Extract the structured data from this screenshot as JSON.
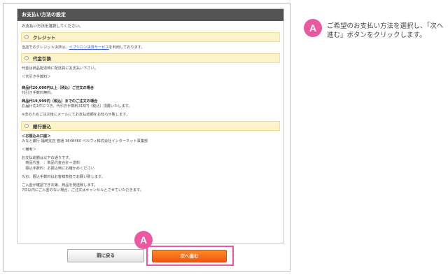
{
  "panel": {
    "title": "お支払い方法の設定",
    "intro": "お支払い方法を選択してください。"
  },
  "options": [
    {
      "label": "クレジット",
      "lines": [
        {
          "before": "当店でのクレジット決済は、",
          "link": "イプシロン決済サービス",
          "after": "を利用しております。"
        }
      ]
    },
    {
      "label": "代金引換",
      "lines": [
        "代金は商品配達時に配達員にお支払い下さい。",
        "",
        "＜代引き手数料＞",
        "",
        "商品代20,000円以上（税込）ご注文の場合",
        "代引き手数料無料。",
        "",
        "商品代19,999円（税込）までのご注文の場合",
        "お届け先1件につき、代引き手数料315円（税込）頂戴いたします。",
        "",
        "※念のためご注文後にメールにてお支払総額をお知らせ致します。"
      ]
    },
    {
      "label": "銀行振込",
      "lines": [
        "＜お振込み口座＞",
        "みなと銀行 福崎支店 普通 3648460 ベルヴィ株式会社インターネット事業部",
        "",
        "＜備考＞",
        "",
        "お支払総額は以下の通りです。",
        "　商品代金　：商品代金合計＋送料",
        "　振込手数料：お振込時にお確かめください",
        "",
        "なお、振込手数料はお客様負担でお願い致します。",
        "",
        "ご入金が確認でき次第、商品を発送致します。",
        "7日以内にご入金のない場合、ご注文はキャンセルとさせていただきます。"
      ]
    }
  ],
  "buttons": {
    "back": "前に戻る",
    "next": "次へ進む"
  },
  "annotation": {
    "badge": "A",
    "note": "ご希望のお支払い方法を選択し、「次へ進む」ボタンをクリックします。"
  },
  "colors": {
    "header": "#545454",
    "option_bg": "#fdf3c8",
    "accent_pink": "#e9599f",
    "next_button": "#f0560f",
    "link": "#2c55d6"
  }
}
